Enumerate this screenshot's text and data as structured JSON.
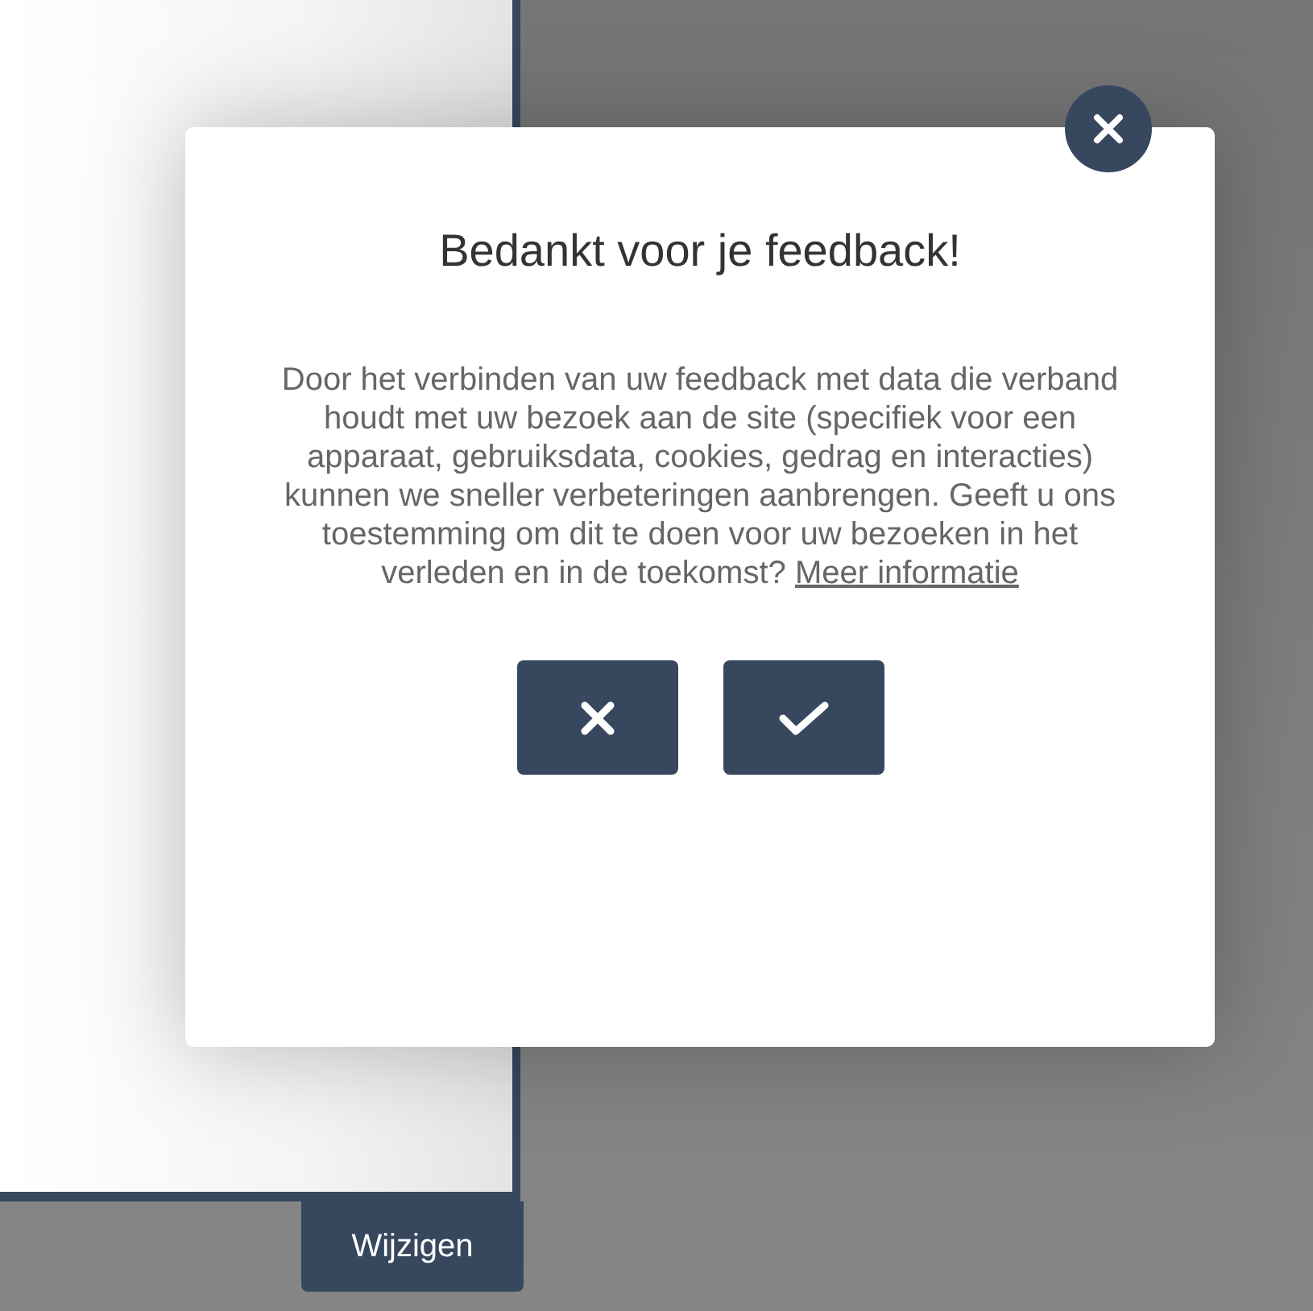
{
  "page": {
    "edit_button": "Wijzigen"
  },
  "dialog": {
    "title": "Bedankt voor je feedback!",
    "message": "Door het verbinden van uw feedback met data die verband houdt met uw bezoek aan de site (specifiek voor een apparaat, gebruiksdata, cookies, gedrag en interacties) kunnen we sneller verbeteringen aanbrengen. Geeft u ons toestemming om dit te doen voor uw bezoeken in het verleden en in de toekomst?",
    "link": "Meer informatie",
    "buttons": [
      {
        "kind": "decline"
      },
      {
        "kind": "accept"
      }
    ]
  }
}
